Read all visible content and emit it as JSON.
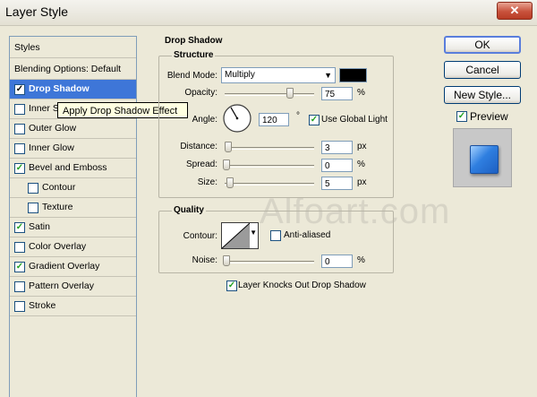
{
  "window": {
    "title": "Layer Style",
    "close_glyph": "✕"
  },
  "styles_panel": {
    "header": "Styles",
    "blending": "Blending Options: Default",
    "items": [
      {
        "label": "Drop Shadow",
        "checked": true,
        "selected": true
      },
      {
        "label": "Inner Shadow",
        "checked": false
      },
      {
        "label": "Outer Glow",
        "checked": false
      },
      {
        "label": "Inner Glow",
        "checked": false
      },
      {
        "label": "Bevel and Emboss",
        "checked": true
      },
      {
        "label": "Contour",
        "checked": false,
        "indent": true
      },
      {
        "label": "Texture",
        "checked": false,
        "indent": true
      },
      {
        "label": "Satin",
        "checked": true
      },
      {
        "label": "Color Overlay",
        "checked": false
      },
      {
        "label": "Gradient Overlay",
        "checked": true
      },
      {
        "label": "Pattern Overlay",
        "checked": false
      },
      {
        "label": "Stroke",
        "checked": false
      }
    ],
    "partial_label": "Inner S"
  },
  "tooltip": "Apply Drop Shadow Effect",
  "drop_shadow": {
    "section_title": "Drop Shadow",
    "structure": {
      "title": "Structure",
      "blend_mode_label": "Blend Mode:",
      "blend_mode_value": "Multiply",
      "shadow_color": "#000000",
      "opacity_label": "Opacity:",
      "opacity_value": "75",
      "opacity_unit": "%",
      "opacity_fraction": 0.75,
      "angle_label": "Angle:",
      "angle_value": "120",
      "angle_unit": "°",
      "use_global_light_label": "Use Global Light",
      "use_global_light": true,
      "distance_label": "Distance:",
      "distance_value": "3",
      "distance_unit": "px",
      "spread_label": "Spread:",
      "spread_value": "0",
      "spread_unit": "%",
      "size_label": "Size:",
      "size_value": "5",
      "size_unit": "px"
    },
    "quality": {
      "title": "Quality",
      "contour_label": "Contour:",
      "anti_aliased_label": "Anti-aliased",
      "anti_aliased": false,
      "noise_label": "Noise:",
      "noise_value": "0",
      "noise_unit": "%"
    },
    "knocks_out_label": "Layer Knocks Out Drop Shadow",
    "knocks_out": true
  },
  "buttons": {
    "ok": "OK",
    "cancel": "Cancel",
    "new_style": "New Style...",
    "preview_label": "Preview",
    "preview": true
  },
  "watermark": "Alfoart.com"
}
